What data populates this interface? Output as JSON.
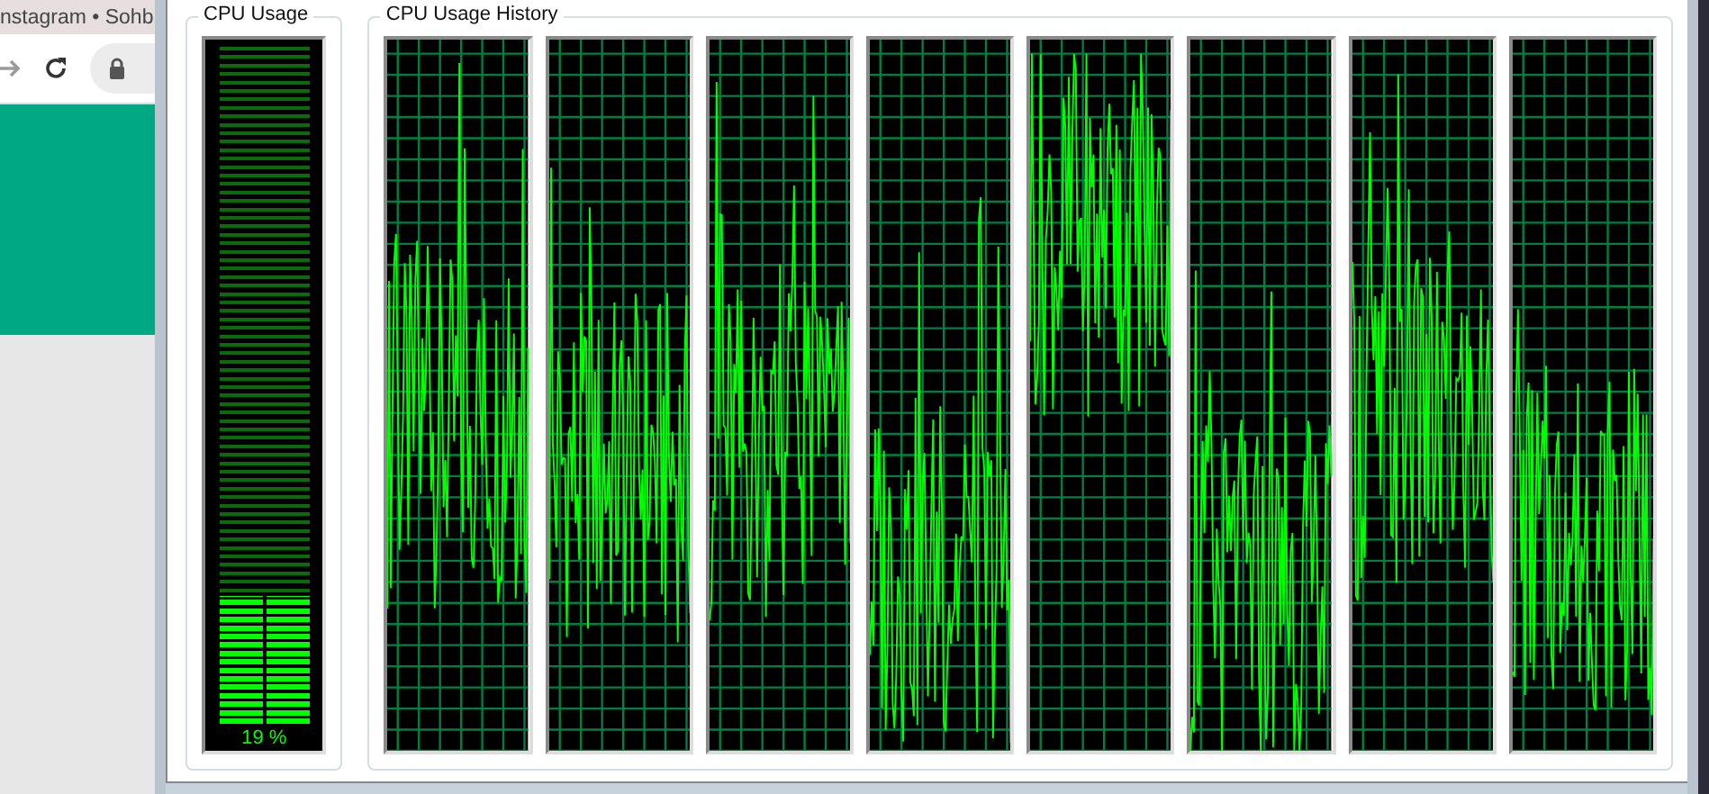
{
  "browser": {
    "tab_title": "nstagram • Sohb"
  },
  "cpu_usage": {
    "title": "CPU Usage",
    "level": 0.19,
    "reading": "19 %"
  },
  "cpu_usage_history": {
    "title": "CPU Usage History",
    "graphs": [
      {
        "kind": "graph"
      },
      {
        "kind": "graph"
      },
      {
        "kind": "graph"
      },
      {
        "kind": "graph"
      },
      {
        "kind": "graph"
      },
      {
        "kind": "graph"
      },
      {
        "kind": "graph"
      },
      {
        "kind": "graph"
      }
    ]
  }
}
